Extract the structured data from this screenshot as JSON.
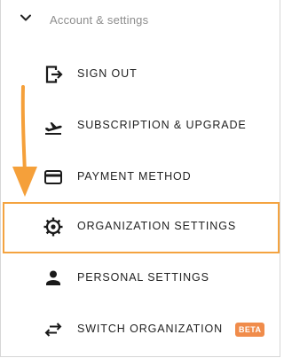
{
  "section": {
    "title": "Account & settings",
    "expanded": true,
    "chevron_icon": "chevron-down-icon"
  },
  "menu": {
    "items": [
      {
        "label": "SIGN OUT",
        "icon": "sign-out-icon"
      },
      {
        "label": "SUBSCRIPTION & UPGRADE",
        "icon": "airplane-takeoff-icon"
      },
      {
        "label": "PAYMENT METHOD",
        "icon": "credit-card-icon"
      },
      {
        "label": "ORGANIZATION SETTINGS",
        "icon": "gear-icon",
        "highlighted": true
      },
      {
        "label": "PERSONAL SETTINGS",
        "icon": "person-icon"
      },
      {
        "label": "SWITCH ORGANIZATION",
        "icon": "swap-arrows-icon",
        "badge": "BETA"
      }
    ]
  },
  "colors": {
    "highlight_border": "#f4a340",
    "arrow": "#f5a03a",
    "badge_background": "#f08c4b",
    "section_title": "#8d8d8d",
    "label_text": "#222222"
  }
}
